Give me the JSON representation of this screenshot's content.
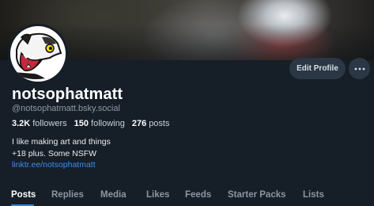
{
  "profile": {
    "display_name": "notsophatmatt",
    "handle": "@notsophatmatt.bsky.social",
    "stats": {
      "followers_count": "3.2K",
      "followers_label": "followers",
      "following_count": "150",
      "following_label": "following",
      "posts_count": "276",
      "posts_label": "posts"
    },
    "bio_line1": "I like making art and things",
    "bio_line2": "+18 plus. Some NSFW",
    "link": "linktr.ee/notsophatmatt"
  },
  "actions": {
    "edit_profile_label": "Edit Profile",
    "more_icon": "ellipsis-icon"
  },
  "tabs": [
    {
      "label": "Posts",
      "active": true
    },
    {
      "label": "Replies"
    },
    {
      "label": "Media"
    },
    {
      "label": "Likes"
    },
    {
      "label": "Feeds"
    },
    {
      "label": "Starter Packs"
    },
    {
      "label": "Lists"
    }
  ],
  "colors": {
    "background": "#161e27",
    "accent": "#1c8bff",
    "link": "#3f8eea",
    "button_bg": "#2b3745",
    "muted_text": "#8c97a3"
  }
}
